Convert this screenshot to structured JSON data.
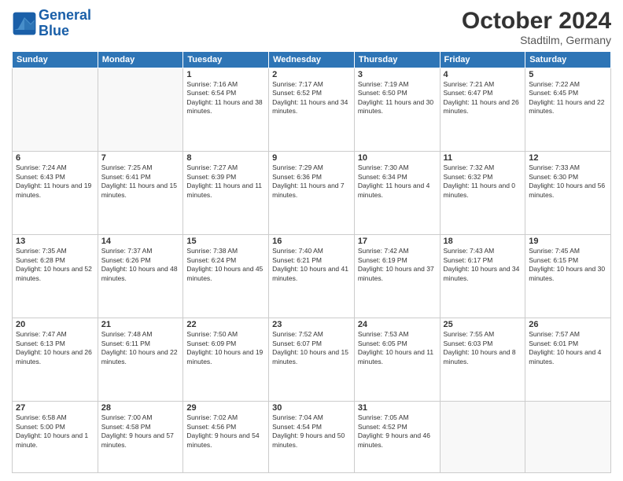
{
  "header": {
    "logo_line1": "General",
    "logo_line2": "Blue",
    "month": "October 2024",
    "location": "Stadtilm, Germany"
  },
  "weekdays": [
    "Sunday",
    "Monday",
    "Tuesday",
    "Wednesday",
    "Thursday",
    "Friday",
    "Saturday"
  ],
  "weeks": [
    [
      {
        "day": "",
        "info": ""
      },
      {
        "day": "",
        "info": ""
      },
      {
        "day": "1",
        "info": "Sunrise: 7:16 AM\nSunset: 6:54 PM\nDaylight: 11 hours and 38 minutes."
      },
      {
        "day": "2",
        "info": "Sunrise: 7:17 AM\nSunset: 6:52 PM\nDaylight: 11 hours and 34 minutes."
      },
      {
        "day": "3",
        "info": "Sunrise: 7:19 AM\nSunset: 6:50 PM\nDaylight: 11 hours and 30 minutes."
      },
      {
        "day": "4",
        "info": "Sunrise: 7:21 AM\nSunset: 6:47 PM\nDaylight: 11 hours and 26 minutes."
      },
      {
        "day": "5",
        "info": "Sunrise: 7:22 AM\nSunset: 6:45 PM\nDaylight: 11 hours and 22 minutes."
      }
    ],
    [
      {
        "day": "6",
        "info": "Sunrise: 7:24 AM\nSunset: 6:43 PM\nDaylight: 11 hours and 19 minutes."
      },
      {
        "day": "7",
        "info": "Sunrise: 7:25 AM\nSunset: 6:41 PM\nDaylight: 11 hours and 15 minutes."
      },
      {
        "day": "8",
        "info": "Sunrise: 7:27 AM\nSunset: 6:39 PM\nDaylight: 11 hours and 11 minutes."
      },
      {
        "day": "9",
        "info": "Sunrise: 7:29 AM\nSunset: 6:36 PM\nDaylight: 11 hours and 7 minutes."
      },
      {
        "day": "10",
        "info": "Sunrise: 7:30 AM\nSunset: 6:34 PM\nDaylight: 11 hours and 4 minutes."
      },
      {
        "day": "11",
        "info": "Sunrise: 7:32 AM\nSunset: 6:32 PM\nDaylight: 11 hours and 0 minutes."
      },
      {
        "day": "12",
        "info": "Sunrise: 7:33 AM\nSunset: 6:30 PM\nDaylight: 10 hours and 56 minutes."
      }
    ],
    [
      {
        "day": "13",
        "info": "Sunrise: 7:35 AM\nSunset: 6:28 PM\nDaylight: 10 hours and 52 minutes."
      },
      {
        "day": "14",
        "info": "Sunrise: 7:37 AM\nSunset: 6:26 PM\nDaylight: 10 hours and 48 minutes."
      },
      {
        "day": "15",
        "info": "Sunrise: 7:38 AM\nSunset: 6:24 PM\nDaylight: 10 hours and 45 minutes."
      },
      {
        "day": "16",
        "info": "Sunrise: 7:40 AM\nSunset: 6:21 PM\nDaylight: 10 hours and 41 minutes."
      },
      {
        "day": "17",
        "info": "Sunrise: 7:42 AM\nSunset: 6:19 PM\nDaylight: 10 hours and 37 minutes."
      },
      {
        "day": "18",
        "info": "Sunrise: 7:43 AM\nSunset: 6:17 PM\nDaylight: 10 hours and 34 minutes."
      },
      {
        "day": "19",
        "info": "Sunrise: 7:45 AM\nSunset: 6:15 PM\nDaylight: 10 hours and 30 minutes."
      }
    ],
    [
      {
        "day": "20",
        "info": "Sunrise: 7:47 AM\nSunset: 6:13 PM\nDaylight: 10 hours and 26 minutes."
      },
      {
        "day": "21",
        "info": "Sunrise: 7:48 AM\nSunset: 6:11 PM\nDaylight: 10 hours and 22 minutes."
      },
      {
        "day": "22",
        "info": "Sunrise: 7:50 AM\nSunset: 6:09 PM\nDaylight: 10 hours and 19 minutes."
      },
      {
        "day": "23",
        "info": "Sunrise: 7:52 AM\nSunset: 6:07 PM\nDaylight: 10 hours and 15 minutes."
      },
      {
        "day": "24",
        "info": "Sunrise: 7:53 AM\nSunset: 6:05 PM\nDaylight: 10 hours and 11 minutes."
      },
      {
        "day": "25",
        "info": "Sunrise: 7:55 AM\nSunset: 6:03 PM\nDaylight: 10 hours and 8 minutes."
      },
      {
        "day": "26",
        "info": "Sunrise: 7:57 AM\nSunset: 6:01 PM\nDaylight: 10 hours and 4 minutes."
      }
    ],
    [
      {
        "day": "27",
        "info": "Sunrise: 6:58 AM\nSunset: 5:00 PM\nDaylight: 10 hours and 1 minute."
      },
      {
        "day": "28",
        "info": "Sunrise: 7:00 AM\nSunset: 4:58 PM\nDaylight: 9 hours and 57 minutes."
      },
      {
        "day": "29",
        "info": "Sunrise: 7:02 AM\nSunset: 4:56 PM\nDaylight: 9 hours and 54 minutes."
      },
      {
        "day": "30",
        "info": "Sunrise: 7:04 AM\nSunset: 4:54 PM\nDaylight: 9 hours and 50 minutes."
      },
      {
        "day": "31",
        "info": "Sunrise: 7:05 AM\nSunset: 4:52 PM\nDaylight: 9 hours and 46 minutes."
      },
      {
        "day": "",
        "info": ""
      },
      {
        "day": "",
        "info": ""
      }
    ]
  ]
}
